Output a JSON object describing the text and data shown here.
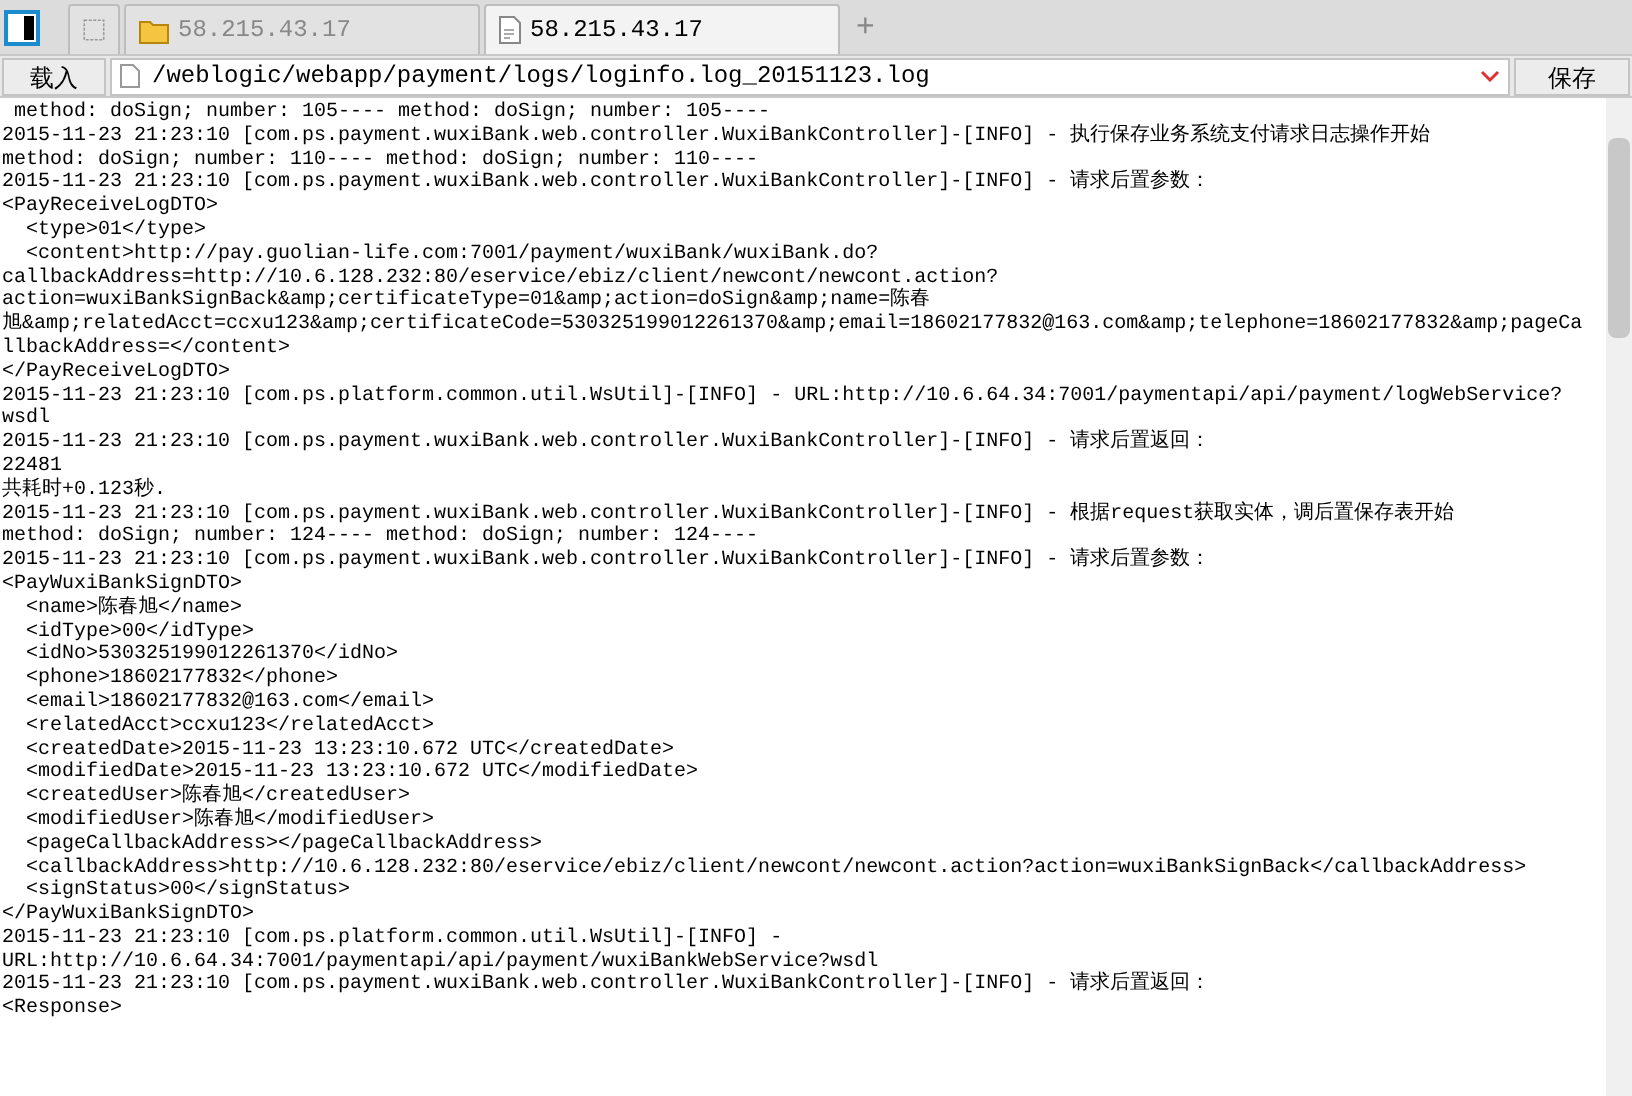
{
  "tabs": [
    {
      "kind": "blank",
      "selected": false
    },
    {
      "kind": "folder",
      "label": "58.215.43.17",
      "selected": false
    },
    {
      "kind": "file",
      "label": "58.215.43.17",
      "selected": true
    }
  ],
  "new_tab": "+",
  "toolbar": {
    "load_button": "载入",
    "path": "/weblogic/webapp/payment/logs/loginfo.log_20151123.log",
    "save_button": "保存"
  },
  "log_lines": [
    " method: doSign; number: 105---- method: doSign; number: 105----",
    "2015-11-23 21:23:10 [com.ps.payment.wuxiBank.web.controller.WuxiBankController]-[INFO] - 执行保存业务系统支付请求日志操作开始",
    "method: doSign; number: 110---- method: doSign; number: 110----",
    "2015-11-23 21:23:10 [com.ps.payment.wuxiBank.web.controller.WuxiBankController]-[INFO] - 请求后置参数：",
    "<PayReceiveLogDTO>",
    "  <type>01</type>",
    "  <content>http://pay.guolian-life.com:7001/payment/wuxiBank/wuxiBank.do?",
    "callbackAddress=http://10.6.128.232:80/eservice/ebiz/client/newcont/newcont.action?",
    "action=wuxiBankSignBack&amp;certificateType=01&amp;action=doSign&amp;name=陈春",
    "旭&amp;relatedAcct=ccxu123&amp;certificateCode=530325199012261370&amp;email=18602177832@163.com&amp;telephone=18602177832&amp;pageCa",
    "llbackAddress=</content>",
    "</PayReceiveLogDTO>",
    "2015-11-23 21:23:10 [com.ps.platform.common.util.WsUtil]-[INFO] - URL:http://10.6.64.34:7001/paymentapi/api/payment/logWebService?",
    "wsdl",
    "2015-11-23 21:23:10 [com.ps.payment.wuxiBank.web.controller.WuxiBankController]-[INFO] - 请求后置返回：",
    "22481",
    "共耗时+0.123秒.",
    "2015-11-23 21:23:10 [com.ps.payment.wuxiBank.web.controller.WuxiBankController]-[INFO] - 根据request获取实体，调后置保存表开始",
    "method: doSign; number: 124---- method: doSign; number: 124----",
    "2015-11-23 21:23:10 [com.ps.payment.wuxiBank.web.controller.WuxiBankController]-[INFO] - 请求后置参数：",
    "<PayWuxiBankSignDTO>",
    "  <name>陈春旭</name>",
    "  <idType>00</idType>",
    "  <idNo>530325199012261370</idNo>",
    "  <phone>18602177832</phone>",
    "  <email>18602177832@163.com</email>",
    "  <relatedAcct>ccxu123</relatedAcct>",
    "  <createdDate>2015-11-23 13:23:10.672 UTC</createdDate>",
    "  <modifiedDate>2015-11-23 13:23:10.672 UTC</modifiedDate>",
    "  <createdUser>陈春旭</createdUser>",
    "  <modifiedUser>陈春旭</modifiedUser>",
    "  <pageCallbackAddress></pageCallbackAddress>",
    "  <callbackAddress>http://10.6.128.232:80/eservice/ebiz/client/newcont/newcont.action?action=wuxiBankSignBack</callbackAddress>",
    "  <signStatus>00</signStatus>",
    "</PayWuxiBankSignDTO>",
    "2015-11-23 21:23:10 [com.ps.platform.common.util.WsUtil]-[INFO] -",
    "URL:http://10.6.64.34:7001/paymentapi/api/payment/wuxiBankWebService?wsdl",
    "2015-11-23 21:23:10 [com.ps.payment.wuxiBank.web.controller.WuxiBankController]-[INFO] - 请求后置返回：",
    "<Response>"
  ]
}
